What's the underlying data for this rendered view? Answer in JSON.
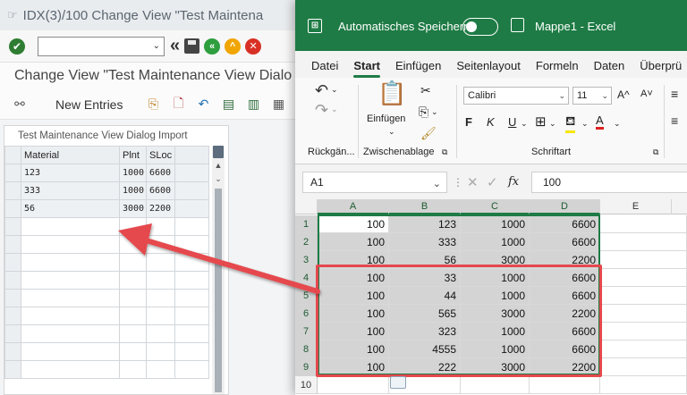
{
  "sap": {
    "window_title": "IDX(3)/100 Change View \"Test Maintena",
    "page_title": "Change View \"Test Maintenance View Dialo",
    "toolbar": {
      "new_entries": "New Entries"
    },
    "table_title": "Test Maintenance View Dialog Import",
    "columns": [
      "Material",
      "Plnt",
      "SLoc"
    ],
    "rows": [
      {
        "material": "123",
        "plnt": "1000",
        "sloc": "6600"
      },
      {
        "material": "333",
        "plnt": "1000",
        "sloc": "6600"
      },
      {
        "material": "56",
        "plnt": "3000",
        "sloc": "2200"
      }
    ]
  },
  "excel": {
    "autosave_label": "Automatisches Speichern",
    "doc_title": "Mappe1  -  Excel",
    "menu_tabs": [
      "Datei",
      "Start",
      "Einfügen",
      "Seitenlayout",
      "Formeln",
      "Daten",
      "Überprü"
    ],
    "active_tab": "Start",
    "ribbon": {
      "undo_label": "Rückgän...",
      "paste_label": "Einfügen",
      "clipboard_label": "Zwischenablage",
      "font_group_label": "Schriftart",
      "font_name": "Calibri",
      "font_size": "11",
      "bold": "F",
      "italic": "K",
      "underline": "U",
      "grow": "A^",
      "shrink": "A˅"
    },
    "name_box": "A1",
    "formula_value": "100",
    "formula_fx": "fx",
    "col_headers": [
      "A",
      "B",
      "C",
      "D",
      "E"
    ],
    "row_headers": [
      "1",
      "2",
      "3",
      "4",
      "5",
      "6",
      "7",
      "8",
      "9",
      "10"
    ],
    "rows": [
      [
        "100",
        "123",
        "1000",
        "6600"
      ],
      [
        "100",
        "333",
        "1000",
        "6600"
      ],
      [
        "100",
        "56",
        "3000",
        "2200"
      ],
      [
        "100",
        "33",
        "1000",
        "6600"
      ],
      [
        "100",
        "44",
        "1000",
        "6600"
      ],
      [
        "100",
        "565",
        "3000",
        "2200"
      ],
      [
        "100",
        "323",
        "1000",
        "6600"
      ],
      [
        "100",
        "4555",
        "1000",
        "6600"
      ],
      [
        "100",
        "222",
        "3000",
        "2200"
      ]
    ],
    "accent_color": "#1e7b45",
    "highlight_color": "#e5484d"
  }
}
